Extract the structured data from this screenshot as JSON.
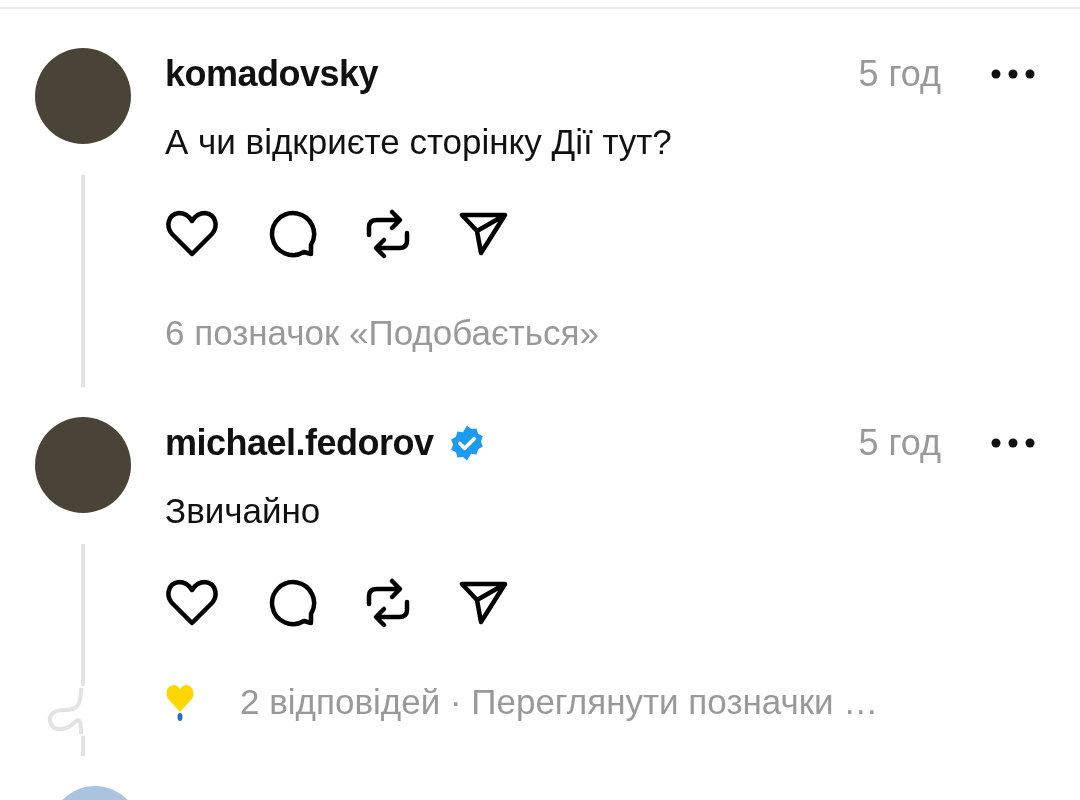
{
  "posts": [
    {
      "username": "komadovsky",
      "verified": false,
      "time": "5 год",
      "text": "А чи відкриєте сторінку Дії тут?",
      "footer": {
        "kind": "likes",
        "text": "6 позначок «Подобається»"
      }
    },
    {
      "username": "michael.fedorov",
      "verified": true,
      "time": "5 год",
      "text": "Звичайно",
      "footer": {
        "kind": "replies",
        "text": "2 відповідей · Переглянути позначки …"
      }
    }
  ]
}
